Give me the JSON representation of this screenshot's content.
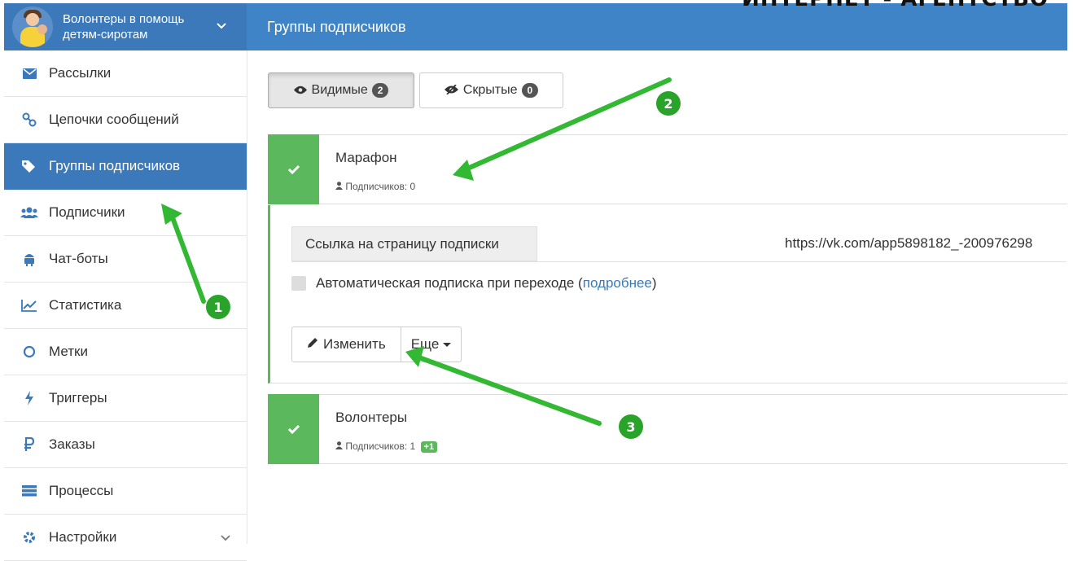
{
  "watermark": "ИНТЕРНЕТ - АГЕНТСТВО",
  "sidebar": {
    "project_title": "Волонтеры в помощь детям-сиротам",
    "items": [
      {
        "label": "Рассылки",
        "icon": "envelope-icon"
      },
      {
        "label": "Цепочки сообщений",
        "icon": "chain-icon"
      },
      {
        "label": "Группы подписчиков",
        "icon": "tags-icon",
        "active": true
      },
      {
        "label": "Подписчики",
        "icon": "users-icon"
      },
      {
        "label": "Чат-боты",
        "icon": "android-icon"
      },
      {
        "label": "Статистика",
        "icon": "line-chart-icon"
      },
      {
        "label": "Метки",
        "icon": "circle-icon"
      },
      {
        "label": "Триггеры",
        "icon": "bolt-icon"
      },
      {
        "label": "Заказы",
        "icon": "ruble-icon"
      },
      {
        "label": "Процессы",
        "icon": "tasks-icon"
      },
      {
        "label": "Настройки",
        "icon": "gear-icon"
      }
    ]
  },
  "header": {
    "title": "Группы подписчиков"
  },
  "filters": {
    "visible": {
      "label": "Видимые",
      "count": "2"
    },
    "hidden": {
      "label": "Скрытые",
      "count": "0"
    }
  },
  "groups": [
    {
      "name": "Марафон",
      "subscribers": "Подписчиков: 0"
    },
    {
      "name": "Волонтеры",
      "subscribers": "Подписчиков: 1",
      "new": "+1"
    }
  ],
  "details": {
    "link_label": "Ссылка на страницу подписки",
    "link_url": "https://vk.com/app5898182_-200976298",
    "auto_sub_text": "Автоматическая подписка при переходе (",
    "auto_sub_link": "подробнее",
    "auto_sub_close": ")",
    "edit_label": "Изменить",
    "more_label": "Еще"
  },
  "annotations": [
    "1",
    "2",
    "3"
  ],
  "colors": {
    "primary": "#3f84c6",
    "success": "#5cb85c",
    "arrow": "#33b833"
  }
}
